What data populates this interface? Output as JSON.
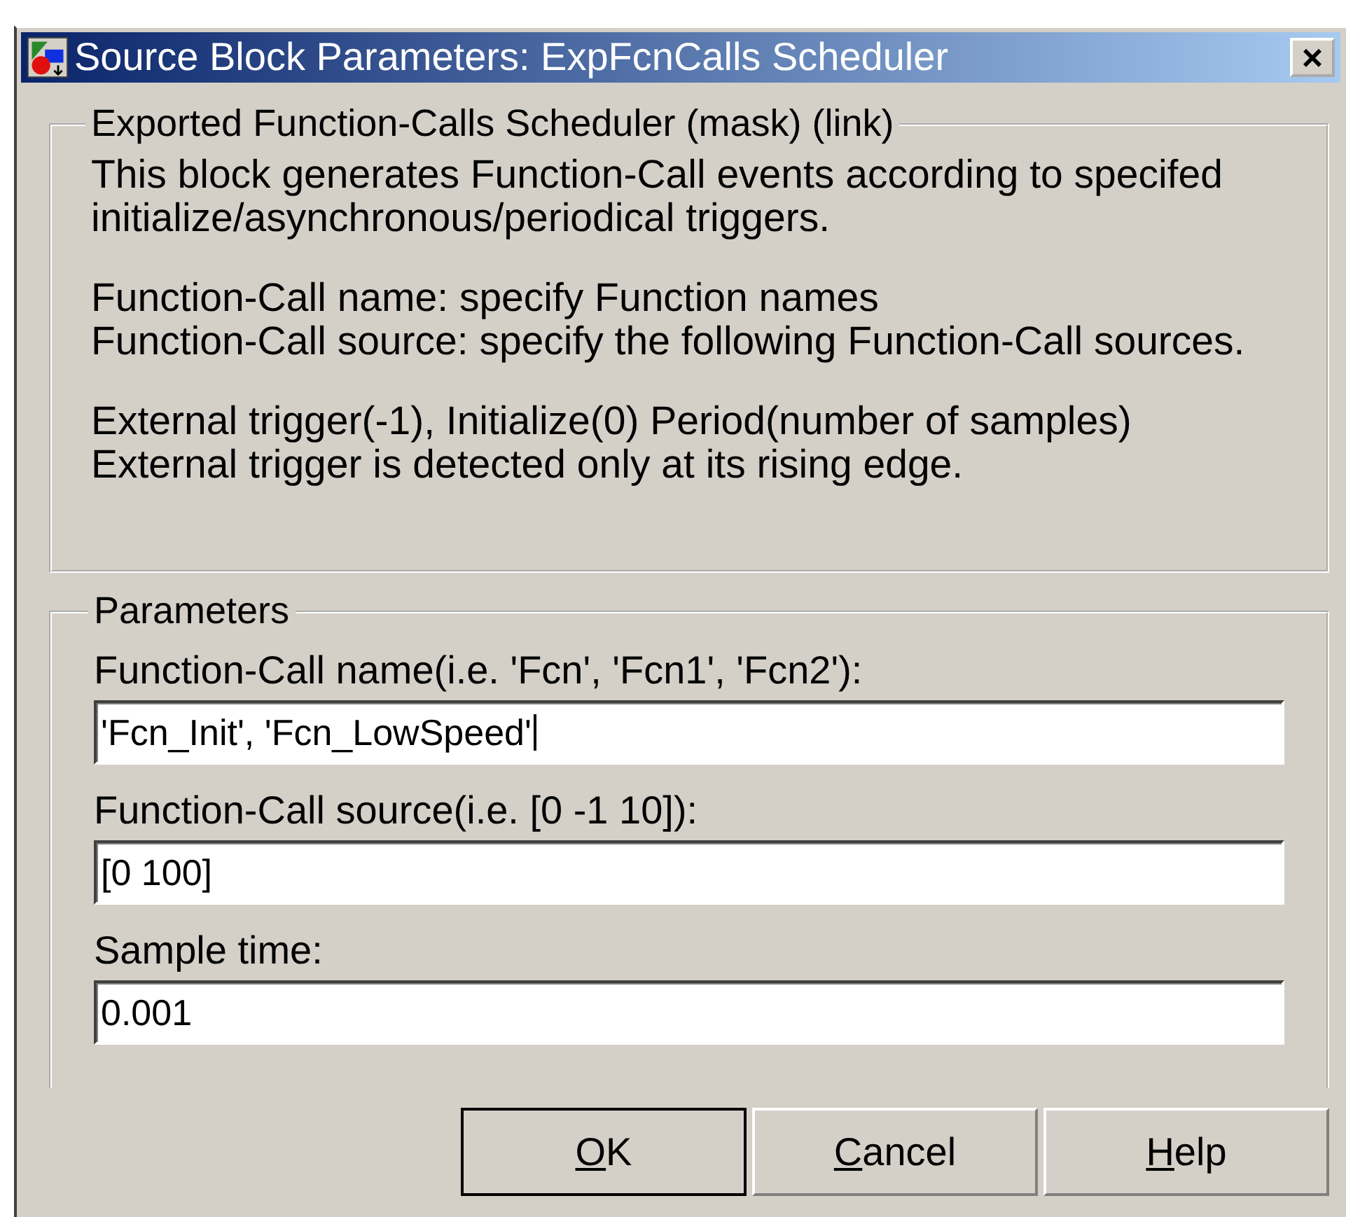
{
  "window": {
    "title": "Source Block Parameters: ExpFcnCalls Scheduler",
    "close": "×"
  },
  "description": {
    "title": "Exported Function-Calls Scheduler (mask) (link)",
    "paragraphs": [
      [
        "This block generates Function-Call events according to specifed",
        "initialize/asynchronous/periodical triggers."
      ],
      [
        "Function-Call name: specify Function names",
        "Function-Call source: specify the following Function-Call sources."
      ],
      [
        "External trigger(-1), Initialize(0) Period(number of samples)",
        "External trigger is detected only at its rising edge."
      ]
    ]
  },
  "parameters": {
    "title": "Parameters",
    "fields": [
      {
        "label": "Function-Call name(i.e. 'Fcn', 'Fcn1', 'Fcn2'):",
        "value": "'Fcn_Init', 'Fcn_LowSpeed'",
        "focused": true
      },
      {
        "label": "Function-Call source(i.e. [0 -1 10]):",
        "value": "[0 100]",
        "focused": false
      },
      {
        "label": "Sample time:",
        "value": "0.001",
        "focused": false
      }
    ]
  },
  "buttons": [
    {
      "label": "OK",
      "default": true
    },
    {
      "label": "Cancel",
      "default": false
    },
    {
      "label": "Help",
      "default": false
    }
  ]
}
